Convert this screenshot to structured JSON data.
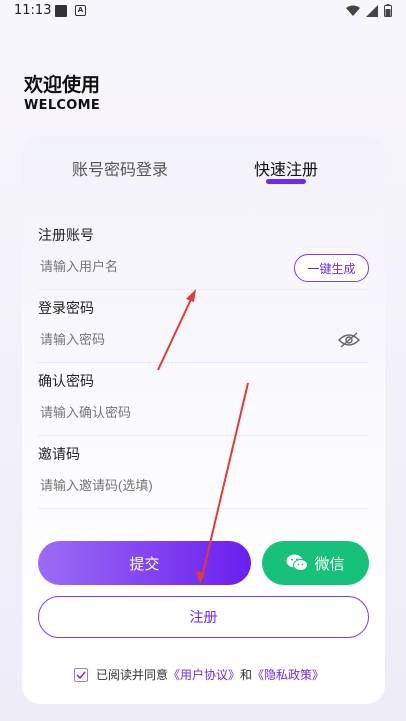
{
  "status_bar": {
    "time": "11:13",
    "a_glyph": "A"
  },
  "header": {
    "title": "欢迎使用",
    "subtitle": "WELCOME"
  },
  "tabs": {
    "login": "账号密码登录",
    "register": "快速注册"
  },
  "fields": {
    "account": {
      "label": "注册账号",
      "placeholder": "请输入用户名",
      "action": "一键生成"
    },
    "password": {
      "label": "登录密码",
      "placeholder": "请输入密码"
    },
    "confirm": {
      "label": "确认密码",
      "placeholder": "请输入确认密码"
    },
    "invite": {
      "label": "邀请码",
      "placeholder": "请输入邀请码(选填)"
    }
  },
  "buttons": {
    "submit": "提交",
    "wechat": "微信",
    "register": "注册"
  },
  "agreement": {
    "prefix": "已阅读并同意",
    "user_agreement": "《用户协议》",
    "and": "和",
    "privacy": "《隐私政策》"
  },
  "colors": {
    "accent": "#6a2cf0",
    "wechat": "#16c27a",
    "annotation": "#e53935"
  }
}
